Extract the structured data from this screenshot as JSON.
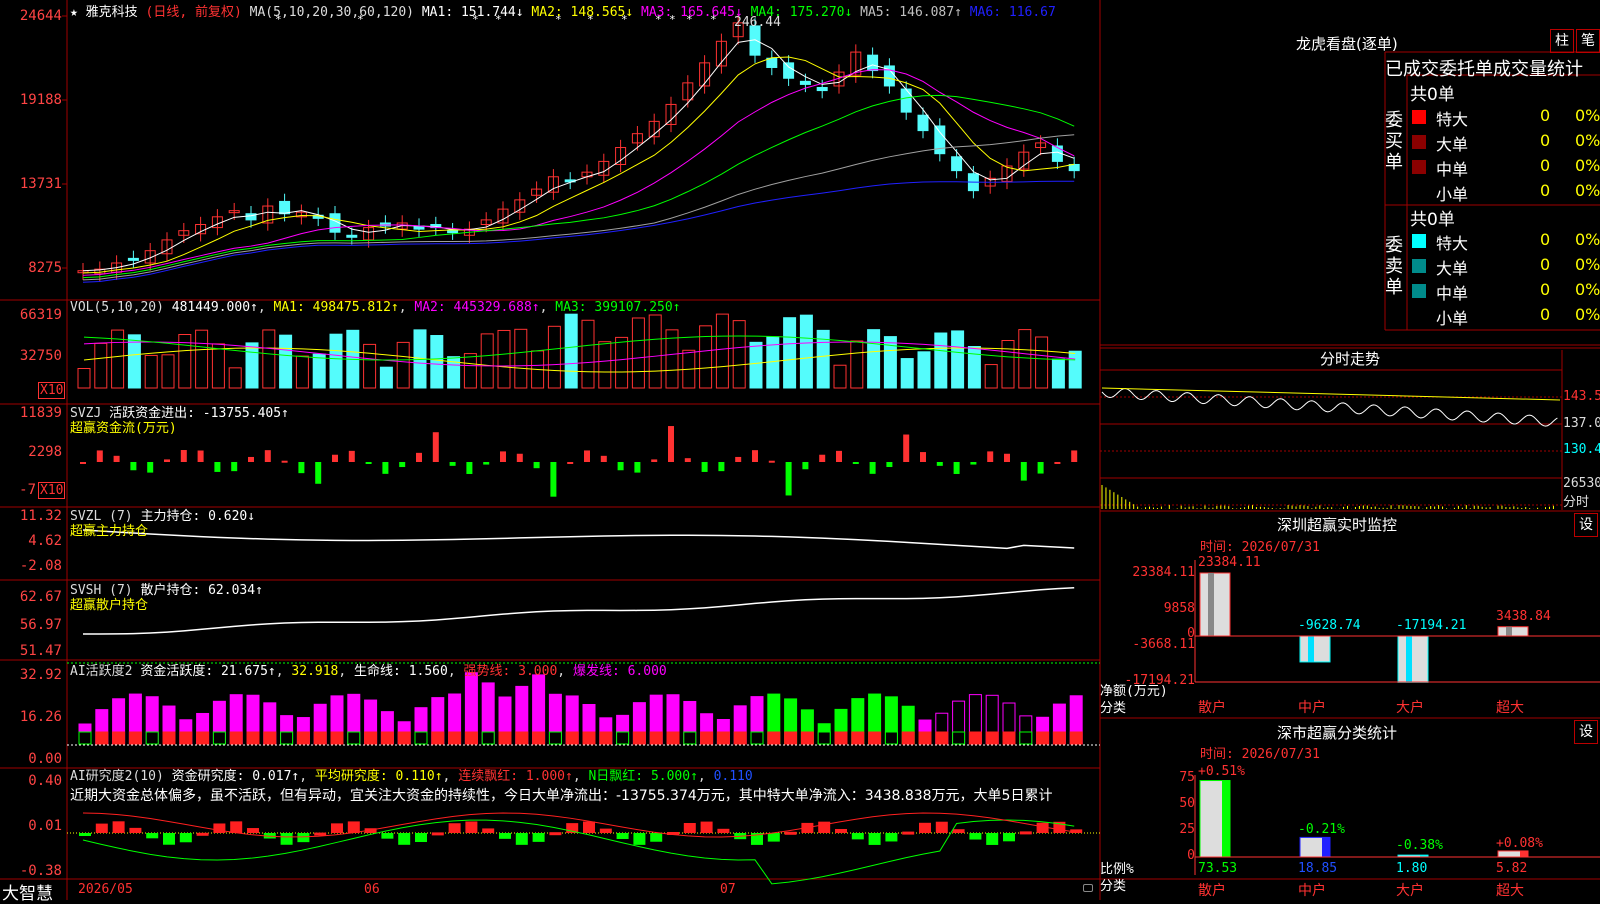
{
  "header": {
    "star": "★",
    "stock_name": "雅克科技",
    "mode": "(日线, 前复权)",
    "ma_label": "MA(5,10,20,30,60,120)",
    "ma1": "MA1: 151.744↓",
    "ma2": "MA2: 148.565↓",
    "ma3": "MA3: 165.645↓",
    "ma4": "MA4: 175.270↓",
    "ma5": "MA5: 146.087↑",
    "ma6": "MA6: 116.67",
    "peak_label": "246.44"
  },
  "price_axis": [
    "24644",
    "19188",
    "13731",
    "8275"
  ],
  "vol": {
    "label": "VOL(5,10,20)",
    "value": "481449.000↑",
    "ma1": "MA1: 498475.812↑",
    "ma2": "MA2: 445329.688↑",
    "ma3": "MA3: 399107.250↑",
    "axis": [
      "66319",
      "32750"
    ],
    "unit": "X10"
  },
  "svzj": {
    "label": "SVZJ",
    "value": "活跃资金进出: -13755.405↑",
    "subtitle": "超赢资金流(万元)",
    "axis": [
      "11839",
      "2298",
      "-7"
    ],
    "unit": "X10"
  },
  "svzl": {
    "label": "SVZL (7)",
    "value": "主力持仓: 0.620↓",
    "subtitle": "超赢主力持仓",
    "axis": [
      "11.32",
      "4.62",
      "-2.08"
    ]
  },
  "svsh": {
    "label": "SVSH (7)",
    "value": "散户持仓: 62.034↑",
    "subtitle": "超赢散户持仓",
    "axis": [
      "62.67",
      "56.97",
      "51.47"
    ]
  },
  "ai_active": {
    "label": "AI活跃度2",
    "v1": "资金活跃度: 21.675↑",
    "v2": "32.918",
    "v3": "生命线: 1.560",
    "v4": "强势线: 3.000",
    "v5": "爆发线: 6.000",
    "axis": [
      "32.92",
      "16.26",
      "0.00"
    ]
  },
  "ai_research": {
    "label": "AI研究度2(10)",
    "v1": "资金研究度: 0.017↑",
    "v2": "平均研究度: 0.110↑",
    "v3": "连续飘红: 1.000↑",
    "v4": "N日飘红: 5.000↑",
    "v5": "0.110",
    "note": "近期大资金总体偏多，虽不活跃，但有异动，宜关注大资金的持续性，今日大单净流出：-13755.374万元，其中特大单净流入：3438.838万元，大单5日累计",
    "axis": [
      "0.40",
      "0.01",
      "-0.38"
    ]
  },
  "bottom": {
    "brand": "大智慧",
    "dates": [
      "2026/05",
      "06",
      "07"
    ]
  },
  "lhb": {
    "title": "龙虎看盘(逐单)",
    "btn1": "柱",
    "btn2": "笔",
    "tabs": "已成交委托单成交量统计",
    "buy_side": "委买单",
    "sell_side": "委卖单",
    "buy_total": "共0单",
    "sell_total": "共0单",
    "rows": [
      {
        "label": "特大",
        "count": "0",
        "pct": "0%",
        "color": "#ff0000"
      },
      {
        "label": "大单",
        "count": "0",
        "pct": "0%",
        "color": "#8b0000"
      },
      {
        "label": "中单",
        "count": "0",
        "pct": "0%",
        "color": "#8b0000"
      },
      {
        "label": "小单",
        "count": "0",
        "pct": "0%",
        "color": "#000000"
      }
    ],
    "sell_rows": [
      {
        "label": "特大",
        "count": "0",
        "pct": "0%",
        "color": "#00ffff"
      },
      {
        "label": "大单",
        "count": "0",
        "pct": "0%",
        "color": "#008b8b"
      },
      {
        "label": "中单",
        "count": "0",
        "pct": "0%",
        "color": "#008b8b"
      },
      {
        "label": "小单",
        "count": "0",
        "pct": "0%",
        "color": "#000000"
      }
    ]
  },
  "intraday": {
    "title": "分时走势",
    "axis": [
      "143.5",
      "137.0",
      "130.4",
      "26530",
      "分时"
    ]
  },
  "monitor": {
    "title": "深圳超赢实时监控",
    "btn": "设",
    "time": "时间: 2026/07/31",
    "axis": [
      "23384.11",
      "9858",
      "0",
      "-3668.11",
      "-17194.21"
    ],
    "axis_label1": "净额(万元)",
    "axis_label2": "分类",
    "categories": [
      "散户",
      "中户",
      "大户",
      "超大"
    ],
    "values": [
      "23384.11",
      "-9628.74",
      "-17194.21",
      "3438.84"
    ],
    "nums": [
      23384.11,
      -9628.74,
      -17194.21,
      3438.84
    ]
  },
  "classify": {
    "title": "深市超赢分类统计",
    "btn": "设",
    "time": "时间: 2026/07/31",
    "axis": [
      "75",
      "50",
      "25",
      "0"
    ],
    "axis_label1": "比例%",
    "axis_label2": "分类",
    "categories": [
      "散户",
      "中户",
      "大户",
      "超大"
    ],
    "changes": [
      "+0.51%",
      "-0.21%",
      "-0.38%",
      "+0.08%"
    ],
    "values": [
      "73.53",
      "18.85",
      "1.80",
      "5.82"
    ],
    "nums": [
      73.53,
      18.85,
      1.8,
      5.82
    ]
  },
  "colors": {
    "up": "#ff3232",
    "down": "#54fcfc",
    "grid": "#a00000",
    "ma1": "#ffffff",
    "ma2": "#ffff00",
    "ma3": "#ff00ff",
    "ma4": "#00ff00",
    "ma5": "#a0a0a0",
    "ma6": "#2020ff"
  }
}
